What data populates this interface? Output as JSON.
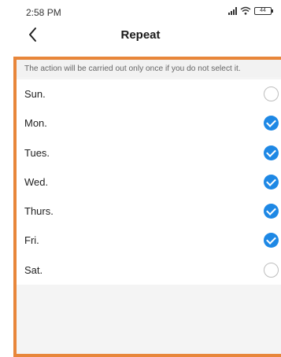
{
  "status_bar": {
    "time": "2:58 PM",
    "icons": [
      "signal-icon",
      "wifi-icon",
      "battery-icon"
    ],
    "battery_level": "44"
  },
  "header": {
    "back_icon": "chevron-left-icon",
    "title": "Repeat"
  },
  "hint": "The action will be carried out only once if you do not select it.",
  "days": [
    {
      "label": "Sun.",
      "selected": false
    },
    {
      "label": "Mon.",
      "selected": true
    },
    {
      "label": "Tues.",
      "selected": true
    },
    {
      "label": "Wed.",
      "selected": true
    },
    {
      "label": "Thurs.",
      "selected": true
    },
    {
      "label": "Fri.",
      "selected": true
    },
    {
      "label": "Sat.",
      "selected": false
    }
  ],
  "colors": {
    "accent": "#1e88e5",
    "highlight_border": "#e8863a"
  }
}
